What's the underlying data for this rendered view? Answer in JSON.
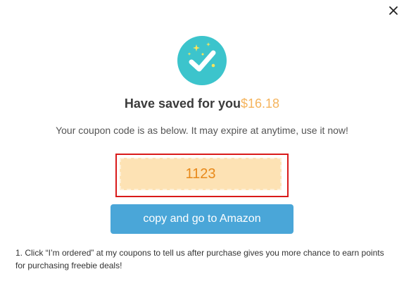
{
  "dialog": {
    "close_icon": "close-icon",
    "badge_icon": "checkmark-sparkle-icon",
    "title_prefix": "Have saved for you",
    "saved_amount": "$16.18",
    "subtitle": "Your coupon code is as below. It may expire at anytime, use it now!",
    "coupon_code": "1123",
    "copy_button_label": "copy and go to Amazon",
    "note": "1. Click “I’m ordered” at my coupons to tell us after purchase gives you more chance to earn points for purchasing freebie deals!"
  },
  "colors": {
    "accent_teal": "#3cc4cc",
    "amount_orange": "#f5b45d",
    "code_bg": "#fde2b4",
    "code_text": "#e8891a",
    "frame_red": "#d91a1a",
    "button_blue": "#4aa6d8"
  }
}
